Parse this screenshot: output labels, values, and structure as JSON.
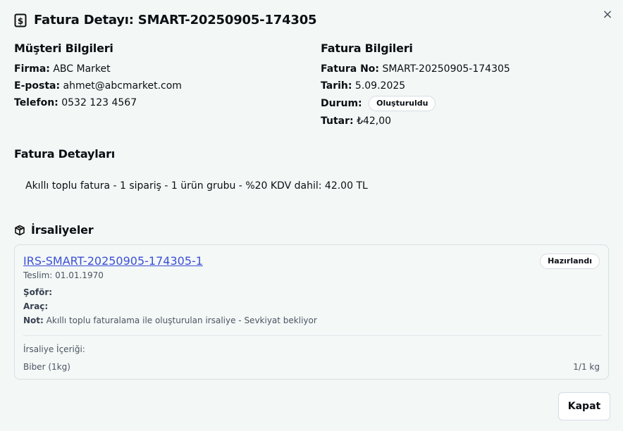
{
  "dialog": {
    "title": "Fatura Detayı: SMART-20250905-174305",
    "close_glyph": "×",
    "icons": {
      "title": "invoice-dollar-icon",
      "shipments": "package-icon",
      "close": "close-icon"
    }
  },
  "customer": {
    "heading": "Müşteri Bilgileri",
    "firma_label": "Firma:",
    "firma": "ABC Market",
    "email_label": "E-posta:",
    "email": "ahmet@abcmarket.com",
    "phone_label": "Telefon:",
    "phone": "0532 123 4567"
  },
  "invoice": {
    "heading": "Fatura Bilgileri",
    "no_label": "Fatura No:",
    "no": "SMART-20250905-174305",
    "date_label": "Tarih:",
    "date": "5.09.2025",
    "status_label": "Durum:",
    "status": "Oluşturuldu",
    "amount_label": "Tutar:",
    "amount": "₺42,00"
  },
  "details": {
    "heading": "Fatura Detayları",
    "text": "Akıllı toplu fatura - 1 sipariş - 1 ürün grubu - %20 KDV dahil: 42.00 TL"
  },
  "shipments": {
    "heading": "İrsaliyeler",
    "items": [
      {
        "code": "IRS-SMART-20250905-174305-1",
        "status": "Hazırlandı",
        "delivery": "Teslim: 01.01.1970",
        "driver_label": "Şoför:",
        "driver": "",
        "vehicle_label": "Araç:",
        "vehicle": "",
        "note_label": "Not:",
        "note": "Akıllı toplu faturalama ile oluşturulan irsaliye - Sevkiyat bekliyor",
        "contents_label": "İrsaliye İçeriği:",
        "contents": [
          {
            "name": "Biber (1kg)",
            "qty": "1/1 kg"
          }
        ]
      }
    ]
  },
  "footer": {
    "close_label": "Kapat"
  }
}
